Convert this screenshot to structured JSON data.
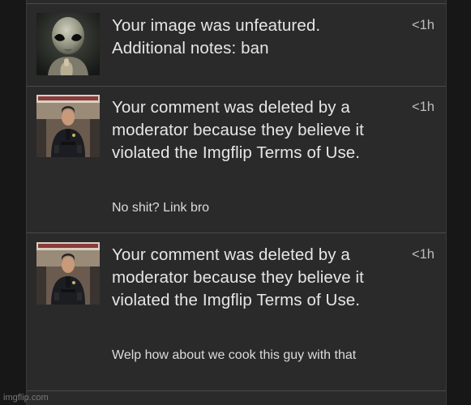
{
  "notifications": [
    {
      "message": "Your image was unfeatured. Additional notes: ban",
      "time": "<1h",
      "thumbnail_icon": "alien-thumbnail"
    },
    {
      "message": "Your comment was deleted by a moderator because they believe it violated the Imgflip Terms of Use.",
      "time": "<1h",
      "comment": "No shit? Link bro",
      "thumbnail_icon": "police-officer-thumbnail"
    },
    {
      "message": "Your comment was deleted by a moderator because they believe it violated the Imgflip Terms of Use.",
      "time": "<1h",
      "comment": "Welp how about we cook this guy with that",
      "thumbnail_icon": "police-officer-thumbnail"
    }
  ],
  "watermark": "imgflip.com",
  "colors": {
    "background": "#171717",
    "panel": "#2a2a2a",
    "divider": "#4a4a4a",
    "text": "#e6e6e6",
    "muted_text": "#bdbdbd"
  }
}
